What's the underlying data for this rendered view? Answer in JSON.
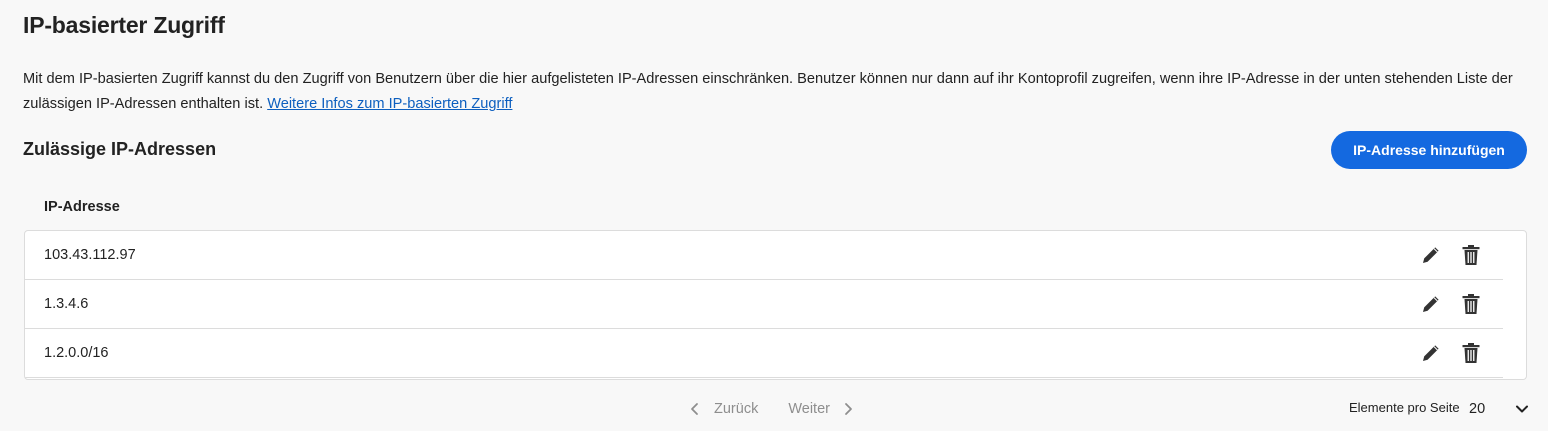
{
  "page": {
    "title": "IP-basierter Zugriff",
    "description": "Mit dem IP-basierten Zugriff kannst du den Zugriff von Benutzern über die hier aufgelisteten IP-Adressen einschränken. Benutzer können nur dann auf ihr Kontoprofil zugreifen, wenn ihre IP-Adresse in der unten stehenden Liste der zulässigen IP-Adressen enthalten ist. ",
    "learn_more_link": "Weitere Infos zum IP-basierten Zugriff"
  },
  "section": {
    "title": "Zulässige IP-Adressen",
    "add_button": "IP-Adresse hinzufügen"
  },
  "table": {
    "column_header": "IP-Adresse",
    "rows": [
      {
        "ip": "103.43.112.97"
      },
      {
        "ip": "1.3.4.6"
      },
      {
        "ip": "1.2.0.0/16"
      }
    ],
    "row_icons": [
      "pencil-icon",
      "trash-icon"
    ]
  },
  "pagination": {
    "prev_label": "Zurück",
    "next_label": "Weiter",
    "items_per_page_label": "Elemente pro Seite",
    "items_per_page_value": "20"
  },
  "colors": {
    "accent": "#1469e0",
    "link": "#0d5fbf",
    "background": "#f8f8f8",
    "disabled_text": "#8e8e8e"
  }
}
